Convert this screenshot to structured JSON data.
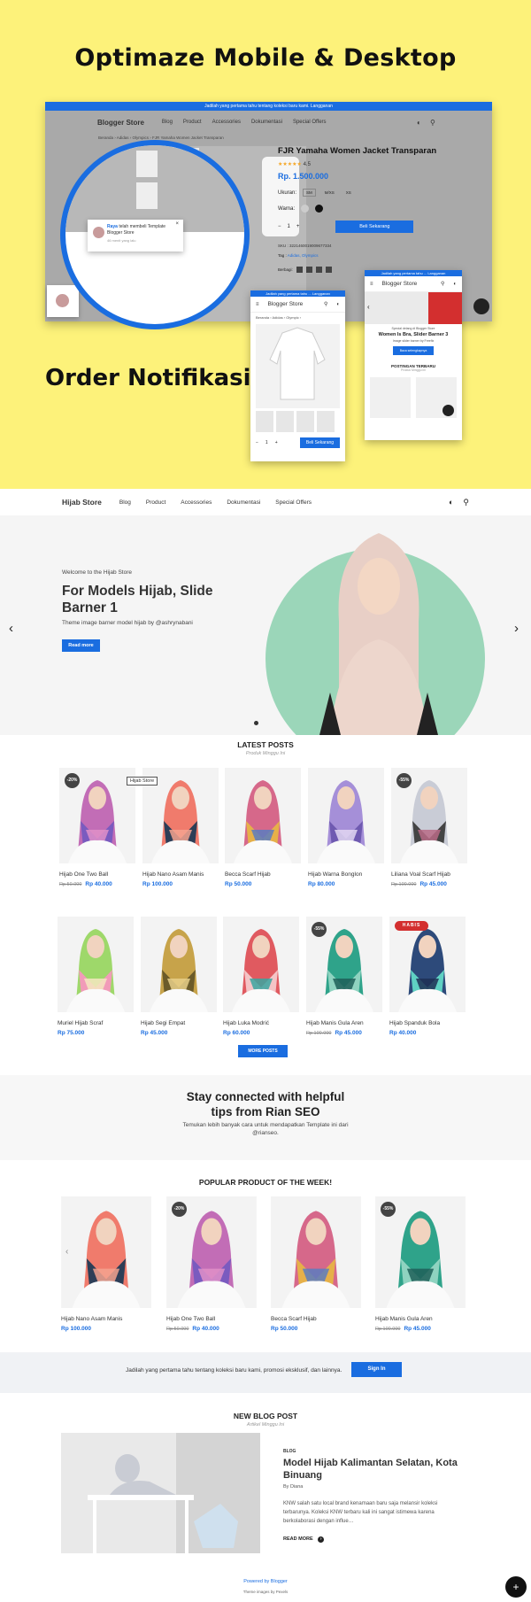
{
  "colors": {
    "accent": "#1a6de0",
    "promo_bg": "#fdf27a",
    "hero_circle": "#9bd6b9",
    "sold_badge": "#d32f2f"
  },
  "promo": {
    "title": "Optimaze Mobile & Desktop",
    "title2": "Order Notifikasi",
    "desktop": {
      "topbar": "Jadilah yang pertama tahu tentang koleksi baru kami. Langganan",
      "brand": "Blogger Store",
      "nav": [
        "Blog",
        "Product",
        "Accessories",
        "Dokumentasi",
        "Special Offers"
      ],
      "breadcrumb": "Beranda › Adidas › Olympics › FJR Yamaha Women Jacket Transparan",
      "product_title": "FJR Yamaha Women Jacket Transparan",
      "rating": "4.5",
      "price": "Rp. 1.500.000",
      "size_label": "Ukuran:",
      "sizes": [
        "SM",
        "M/XS",
        "XS"
      ],
      "color_label": "Warna:",
      "buy": "Beli Sekarang",
      "sku": "SKU : 3221460019009677334",
      "tag_label": "Tag :",
      "tags": "Adidas, Olympics",
      "share_label": "Berbagi:",
      "notif_name": "Raya",
      "notif_text": "telah membeli Template Blogger Store",
      "notif_time": "46 menit yang lalu"
    },
    "phone1": {
      "topbar": "Jadilah yang pertama tahu ... Langganan",
      "brand": "Blogger Store",
      "crumb": "Beranda › Adidas › Olympic ›",
      "qty": "1",
      "buy": "Beli Sekarang"
    },
    "phone2": {
      "topbar": "Jadilah yang pertama tahu ... Langganan",
      "brand": "Blogger Store",
      "slide_small": "Special delang di Blogger Store",
      "slide_title": "Women Is Bra, Slider Barner 3",
      "slide_desc": "Image slider barner by Freefix",
      "slide_btn": "Baca selengkapnya",
      "posts_title": "POSTINGAN TERBARU",
      "posts_sub": "Produk Minggu ini"
    }
  },
  "site": {
    "brand": "Hijab Store",
    "nav": [
      "Blog",
      "Product",
      "Accessories",
      "Dokumentasi",
      "Special Offers"
    ]
  },
  "hero": {
    "welcome": "Welcome to the Hijab Store",
    "title": "For Models Hijab, Slide Barner 1",
    "desc": "Theme image barner model hijab by @ashrynabani",
    "button": "Read more",
    "prev": "‹",
    "next": "›"
  },
  "latest": {
    "title": "LATEST POSTS",
    "subtitle": "Produk Minggu Ini",
    "store_tag": "Hijab Store",
    "products": [
      {
        "name": "Hijab One Two Ball",
        "old": "Rp 50.000",
        "price": "Rp 40.000",
        "badge": "-20%"
      },
      {
        "name": "Hijab Nano Asam Manis",
        "old": "",
        "price": "Rp 100.000",
        "badge": ""
      },
      {
        "name": "Becca Scarf Hijab",
        "old": "",
        "price": "Rp 50.000",
        "badge": ""
      },
      {
        "name": "Hijab Warna Bonglon",
        "old": "",
        "price": "Rp 80.000",
        "badge": ""
      },
      {
        "name": "Liliana Voal Scarf Hijab",
        "old": "Rp 100.000",
        "price": "Rp 45.000",
        "badge": "-55%"
      },
      {
        "name": "Muriel Hijab Scraf",
        "old": "",
        "price": "Rp 75.000",
        "badge": ""
      },
      {
        "name": "Hijab Segi Empat",
        "old": "",
        "price": "Rp 45.000",
        "badge": ""
      },
      {
        "name": "Hijab Luka Modrić",
        "old": "",
        "price": "Rp 60.000",
        "badge": ""
      },
      {
        "name": "Hijab Manis Gula Aren",
        "old": "Rp 100.000",
        "price": "Rp 45.000",
        "badge": "-55%"
      },
      {
        "name": "Hijab Spanduk Bola",
        "old": "",
        "price": "Rp 40.000",
        "badge": "",
        "sold": "HABIS"
      }
    ],
    "more": "MORE POSTS"
  },
  "stay": {
    "title": "Stay connected with helpful tips from Rian SEO",
    "desc": "Temukan lebih banyak cara untuk mendapatkan Template ini dari @rianseo."
  },
  "popular": {
    "title": "POPULAR PRODUCT OF THE WEEK!",
    "prev": "‹",
    "products": [
      {
        "name": "Hijab Nano Asam Manis",
        "old": "",
        "price": "Rp 100.000",
        "badge": ""
      },
      {
        "name": "Hijab One Two Ball",
        "old": "Rp 50.000",
        "price": "Rp 40.000",
        "badge": "-20%"
      },
      {
        "name": "Becca Scarf Hijab",
        "old": "",
        "price": "Rp 50.000",
        "badge": ""
      },
      {
        "name": "Hijab Manis Gula Aren",
        "old": "Rp 100.000",
        "price": "Rp 45.000",
        "badge": "-55%"
      }
    ]
  },
  "newsletter": {
    "text": "Jadilah yang pertama tahu tentang koleksi baru kami, promosi eksklusif, dan lainnya.",
    "button": "Sign In"
  },
  "blog": {
    "title": "NEW BLOG POST",
    "subtitle": "Artikel Minggu Ini",
    "category": "BLOG",
    "post_title": "Model Hijab Kalimantan Selatan, Kota Binuang",
    "author": "By Diana",
    "excerpt": "KNW salah satu local brand kenamaan baru saja melansir koleksi terbarunya. Koleksi KNW terbaru kali ini sangat istimewa karena berkolaborasi dengan influe…",
    "read_more": "READ MORE"
  },
  "footer": {
    "powered": "Powered by Blogger",
    "theme": "Theme images by Pexels",
    "fab": "+"
  }
}
